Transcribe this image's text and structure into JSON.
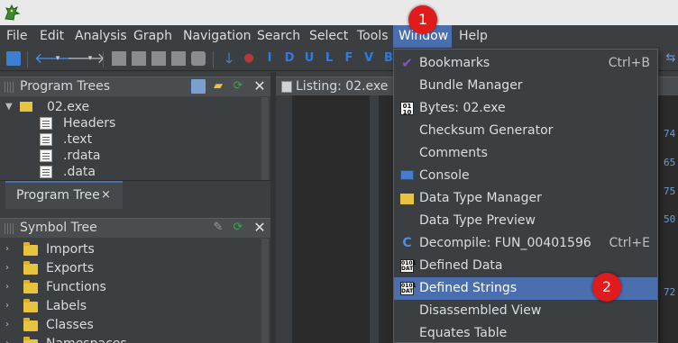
{
  "menubar": {
    "items": [
      "File",
      "Edit",
      "Analysis",
      "Graph",
      "Navigation",
      "Search",
      "Select",
      "Tools",
      "Window",
      "Help"
    ],
    "active": "Window"
  },
  "toolbar": {
    "letters": [
      "I",
      "D",
      "U",
      "L",
      "F",
      "V",
      "B"
    ]
  },
  "program_trees": {
    "title": "Program Trees",
    "root": "02.exe",
    "children": [
      "Headers",
      ".text",
      ".rdata",
      ".data"
    ],
    "tab_label": "Program Tree",
    "tab_close": "×"
  },
  "symbol_tree": {
    "title": "Symbol Tree",
    "items": [
      "Imports",
      "Exports",
      "Functions",
      "Labels",
      "Classes",
      "Namespaces"
    ]
  },
  "listing": {
    "title": "Listing:  02.exe",
    "right_values": [
      "74",
      "65",
      "75",
      "50",
      "72"
    ]
  },
  "window_menu": {
    "items": [
      {
        "label": "Bookmarks",
        "shortcut": "Ctrl+B",
        "icon": "checkmark-icon"
      },
      {
        "label": "Bundle Manager",
        "shortcut": "",
        "icon": ""
      },
      {
        "label": "Bytes: 02.exe",
        "shortcut": "",
        "icon": "bytes-icon"
      },
      {
        "label": "Checksum Generator",
        "shortcut": "",
        "icon": ""
      },
      {
        "label": "Comments",
        "shortcut": "",
        "icon": ""
      },
      {
        "label": "Console",
        "shortcut": "",
        "icon": "monitor-icon"
      },
      {
        "label": "Data Type Manager",
        "shortcut": "",
        "icon": "folder-icon"
      },
      {
        "label": "Data Type Preview",
        "shortcut": "",
        "icon": ""
      },
      {
        "label": "Decompile: FUN_00401596",
        "shortcut": "Ctrl+E",
        "icon": "decompile-icon"
      },
      {
        "label": "Defined Data",
        "shortcut": "",
        "icon": "dat-icon"
      },
      {
        "label": "Defined Strings",
        "shortcut": "",
        "icon": "dat-icon"
      },
      {
        "label": "Disassembled View",
        "shortcut": "",
        "icon": ""
      },
      {
        "label": "Equates Table",
        "shortcut": "",
        "icon": ""
      }
    ],
    "highlighted": "Defined Strings"
  },
  "annotations": [
    "1",
    "2"
  ],
  "colors": {
    "accent": "#4b6eaf",
    "badge": "#e01b1b",
    "background": "#3c3f41"
  }
}
